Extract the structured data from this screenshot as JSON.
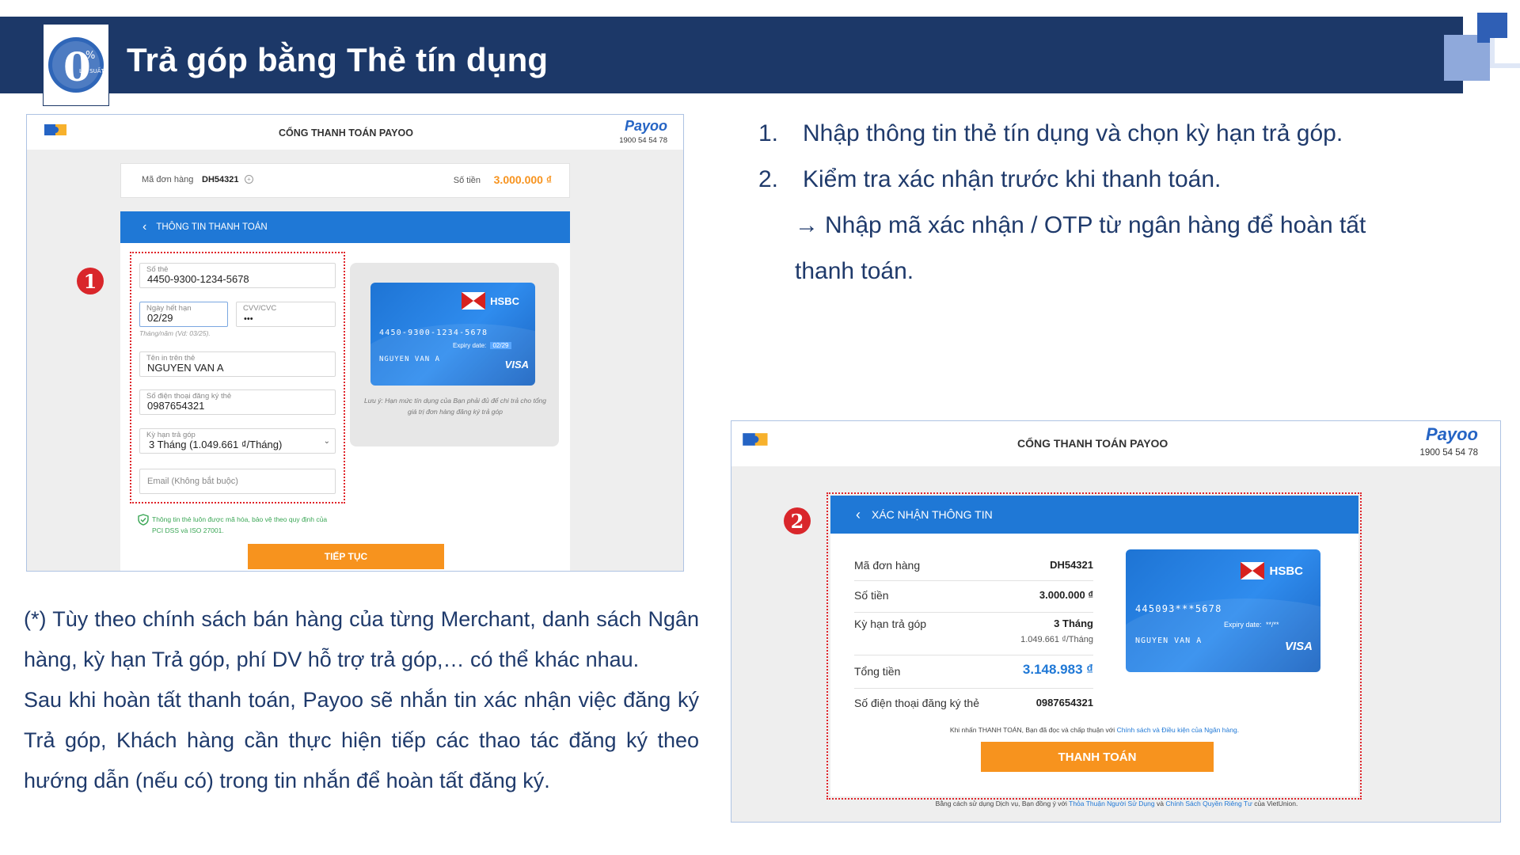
{
  "header": {
    "title": "Trả góp bằng Thẻ tín dụng",
    "logo_text": "0",
    "logo_sub": "LÃI SUẤT",
    "logo_mark": "%"
  },
  "screen1": {
    "portal_title": "CỔNG THANH TOÁN PAYOO",
    "brand": "Payoo",
    "hotline": "1900 54 54 78",
    "order_label": "Mã đơn hàng",
    "order_value": "DH54321",
    "amount_label": "Số tiền",
    "amount_value": "3.000.000 ₫",
    "section_title": "THÔNG TIN THANH TOÁN",
    "badge": "1",
    "fields": {
      "card_number_label": "Số thẻ",
      "card_number_value": "4450-9300-1234-5678",
      "expiry_label": "Ngày hết hạn",
      "expiry_value": "02/29",
      "expiry_hint": "Tháng/năm (Vd: 03/25).",
      "cvv_label": "CVV/CVC",
      "cvv_value": "•••",
      "name_label": "Tên in trên thẻ",
      "name_value": "NGUYEN VAN A",
      "phone_label": "Số điện thoại đăng ký thẻ",
      "phone_value": "0987654321",
      "term_label": "Kỳ hạn trả góp",
      "term_value": "3 Tháng (1.049.661 ₫/Tháng)",
      "email_placeholder": "Email (Không bắt buộc)"
    },
    "security_note": "Thông tin thẻ luôn được mã hóa, bảo vệ theo quy định của PCI DSS và ISO 27001.",
    "card": {
      "bank": "HSBC",
      "number": "4450-9300-1234-5678",
      "expiry_label": "Expiry date:",
      "expiry_value": "02/29",
      "holder": "NGUYEN VAN A",
      "network": "VISA"
    },
    "card_note": "Lưu ý: Hạn mức tín dụng của Bạn phải đủ để chi trả cho tổng giá trị đơn hàng đăng ký trả góp",
    "continue_button": "TIẾP TỤC"
  },
  "steps": {
    "s1_num": "1.",
    "s1": "Nhập thông tin thẻ tín dụng và chọn kỳ hạn trả góp.",
    "s2_num": "2.",
    "s2": "Kiểm tra xác nhận trước khi thanh toán.",
    "s2_arrow": "→",
    "s2_sub_line1": "Nhập mã xác nhận / OTP từ ngân hàng để hoàn tất",
    "s2_sub_line2": "thanh toán."
  },
  "screen2": {
    "portal_title": "CỔNG THANH TOÁN PAYOO",
    "brand": "Payoo",
    "hotline": "1900 54 54 78",
    "badge": "2",
    "section_title": "XÁC NHẬN THÔNG TIN",
    "rows": {
      "order_label": "Mã đơn hàng",
      "order_value": "DH54321",
      "amount_label": "Số tiền",
      "amount_value": "3.000.000 ₫",
      "term_label": "Kỳ hạn trả góp",
      "term_value": "3 Tháng",
      "term_sub": "1.049.661 ₫/Tháng",
      "total_label": "Tổng tiền",
      "total_value": "3.148.983 ₫",
      "phone_label": "Số điện thoại đăng ký thẻ",
      "phone_value": "0987654321"
    },
    "card": {
      "bank": "HSBC",
      "number": "445093***5678",
      "expiry_label": "Expiry date:",
      "expiry_value": "**/**",
      "holder": "NGUYEN VAN A",
      "network": "VISA"
    },
    "terms_prefix": "Khi nhấn THANH TOÁN, Bạn đã đọc và chấp thuận với",
    "terms_link": "Chính sách và Điều kiện của Ngân hàng.",
    "pay_button": "THANH TOÁN",
    "footer_prefix": "Bằng cách sử dụng Dịch vụ, Bạn đồng ý với",
    "footer_link1": "Thỏa Thuận Người Sử Dụng",
    "footer_and": "và",
    "footer_link2": "Chính Sách Quyền Riêng Tư",
    "footer_suffix": "của VietUnion."
  },
  "notes": {
    "p1": "(*) Tùy theo chính sách bán hàng của từng Merchant, danh sách Ngân hàng, kỳ hạn Trả góp, phí DV hỗ trợ trả góp,… có thể khác nhau.",
    "p2": "Sau khi hoàn tất thanh toán, Payoo sẽ nhắn tin xác nhận việc đăng ký Trả góp, Khách hàng cần thực hiện tiếp các thao tác đăng ký theo hướng dẫn (nếu có) trong tin nhắn để hoàn tất đăng ký."
  },
  "colors": {
    "navy": "#1c3868",
    "payoo_blue": "#1f78d6",
    "orange": "#f7931e",
    "red": "#d9262b"
  }
}
